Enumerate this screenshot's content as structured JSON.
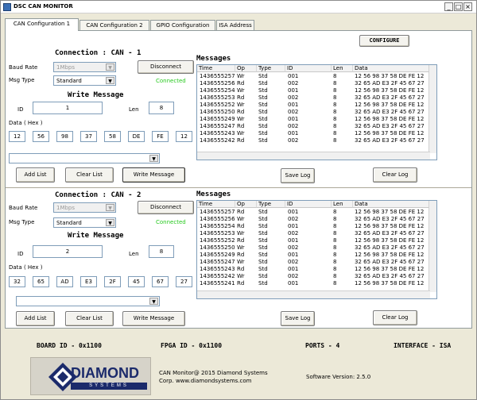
{
  "window": {
    "title": "DSC CAN MONITOR"
  },
  "tabs": [
    {
      "label": "CAN Configuration 1"
    },
    {
      "label": "CAN Configuration 2"
    },
    {
      "label": "GPIO Configuration"
    },
    {
      "label": "ISA Address"
    }
  ],
  "configure_label": "CONFIGURE",
  "can1": {
    "heading": "Connection : CAN - 1",
    "baud_label": "Baud Rate",
    "baud_value": "1Mbps",
    "msgtype_label": "Msg Type",
    "msgtype_value": "Standard",
    "disconnect_label": "Disconnect",
    "status": "Connected",
    "write_heading": "Write Message",
    "id_label": "ID",
    "id_value": "1",
    "len_label": "Len",
    "len_value": "8",
    "data_label": "Data ( Hex )",
    "data_bytes": [
      "12",
      "56",
      "98",
      "37",
      "58",
      "DE",
      "FE",
      "12"
    ],
    "add_list": "Add List",
    "clear_list": "Clear List",
    "write_message": "Write Message"
  },
  "can2": {
    "heading": "Connection : CAN - 2",
    "baud_label": "Baud Rate",
    "baud_value": "1Mbps",
    "msgtype_label": "Msg Type",
    "msgtype_value": "Standard",
    "disconnect_label": "Disconnect",
    "status": "Connected",
    "write_heading": "Write Message",
    "id_label": "ID",
    "id_value": "2",
    "len_label": "Len",
    "len_value": "8",
    "data_label": "Data ( Hex )",
    "data_bytes": [
      "32",
      "65",
      "AD",
      "E3",
      "2F",
      "45",
      "67",
      "27"
    ],
    "add_list": "Add List",
    "clear_list": "Clear List",
    "write_message": "Write Message"
  },
  "log1": {
    "heading": "Messages",
    "columns": [
      "Time",
      "Op",
      "Type",
      "ID",
      "Len",
      "Data"
    ],
    "rows": [
      [
        "1436555257",
        "Wr",
        "Std",
        "001",
        "8",
        "12 56 98 37 58 DE FE 12"
      ],
      [
        "1436555256",
        "Rd",
        "Std",
        "002",
        "8",
        "32 65 AD E3 2F 45 67 27"
      ],
      [
        "1436555254",
        "Wr",
        "Std",
        "001",
        "8",
        "12 56 98 37 58 DE FE 12"
      ],
      [
        "1436555253",
        "Rd",
        "Std",
        "002",
        "8",
        "32 65 AD E3 2F 45 67 27"
      ],
      [
        "1436555252",
        "Wr",
        "Std",
        "001",
        "8",
        "12 56 98 37 58 DE FE 12"
      ],
      [
        "1436555250",
        "Rd",
        "Std",
        "002",
        "8",
        "32 65 AD E3 2F 45 67 27"
      ],
      [
        "1436555249",
        "Wr",
        "Std",
        "001",
        "8",
        "12 56 98 37 58 DE FE 12"
      ],
      [
        "1436555247",
        "Rd",
        "Std",
        "002",
        "8",
        "32 65 AD E3 2F 45 67 27"
      ],
      [
        "1436555243",
        "Wr",
        "Std",
        "001",
        "8",
        "12 56 98 37 58 DE FE 12"
      ],
      [
        "1436555242",
        "Rd",
        "Std",
        "002",
        "8",
        "32 65 AD E3 2F 45 67 27"
      ]
    ],
    "save_log": "Save Log",
    "clear_log": "Clear Log"
  },
  "log2": {
    "heading": "Messages",
    "columns": [
      "Time",
      "Op",
      "Type",
      "ID",
      "Len",
      "Data"
    ],
    "rows": [
      [
        "1436555257",
        "Rd",
        "Std",
        "001",
        "8",
        "12 56 98 37 58 DE FE 12"
      ],
      [
        "1436555256",
        "Wr",
        "Std",
        "002",
        "8",
        "32 65 AD E3 2F 45 67 27"
      ],
      [
        "1436555254",
        "Rd",
        "Std",
        "001",
        "8",
        "12 56 98 37 58 DE FE 12"
      ],
      [
        "1436555253",
        "Wr",
        "Std",
        "002",
        "8",
        "32 65 AD E3 2F 45 67 27"
      ],
      [
        "1436555252",
        "Rd",
        "Std",
        "001",
        "8",
        "12 56 98 37 58 DE FE 12"
      ],
      [
        "1436555250",
        "Wr",
        "Std",
        "002",
        "8",
        "32 65 AD E3 2F 45 67 27"
      ],
      [
        "1436555249",
        "Rd",
        "Std",
        "001",
        "8",
        "12 56 98 37 58 DE FE 12"
      ],
      [
        "1436555247",
        "Wr",
        "Std",
        "002",
        "8",
        "32 65 AD E3 2F 45 67 27"
      ],
      [
        "1436555243",
        "Rd",
        "Std",
        "001",
        "8",
        "12 56 98 37 58 DE FE 12"
      ],
      [
        "1436555242",
        "Wr",
        "Std",
        "002",
        "8",
        "32 65 AD E3 2F 45 67 27"
      ],
      [
        "1436555241",
        "Rd",
        "Std",
        "001",
        "8",
        "12 56 98 37 58 DE FE 12"
      ]
    ],
    "save_log": "Save Log",
    "clear_log": "Clear Log"
  },
  "footer": {
    "board_id": "BOARD ID - 0x1100",
    "fpga_id": "FPGA ID - 0x1100",
    "ports": "PORTS - 4",
    "interface": "INTERFACE - ISA",
    "logo_text": "DIAMOND",
    "logo_sub": "SYSTEMS",
    "copyright_line1": "CAN Monitor@ 2015  Diamond Systems",
    "copyright_line2": "Corp. www.diamondsystems.com",
    "version": "Software Version: 2.5.0"
  },
  "colors": {
    "connected": "#27c91f",
    "logo_blue": "#1b2a6b"
  },
  "icons": {
    "app": "can-monitor-icon",
    "minimize": "minimize-icon",
    "maximize": "maximize-icon",
    "close": "close-icon"
  }
}
